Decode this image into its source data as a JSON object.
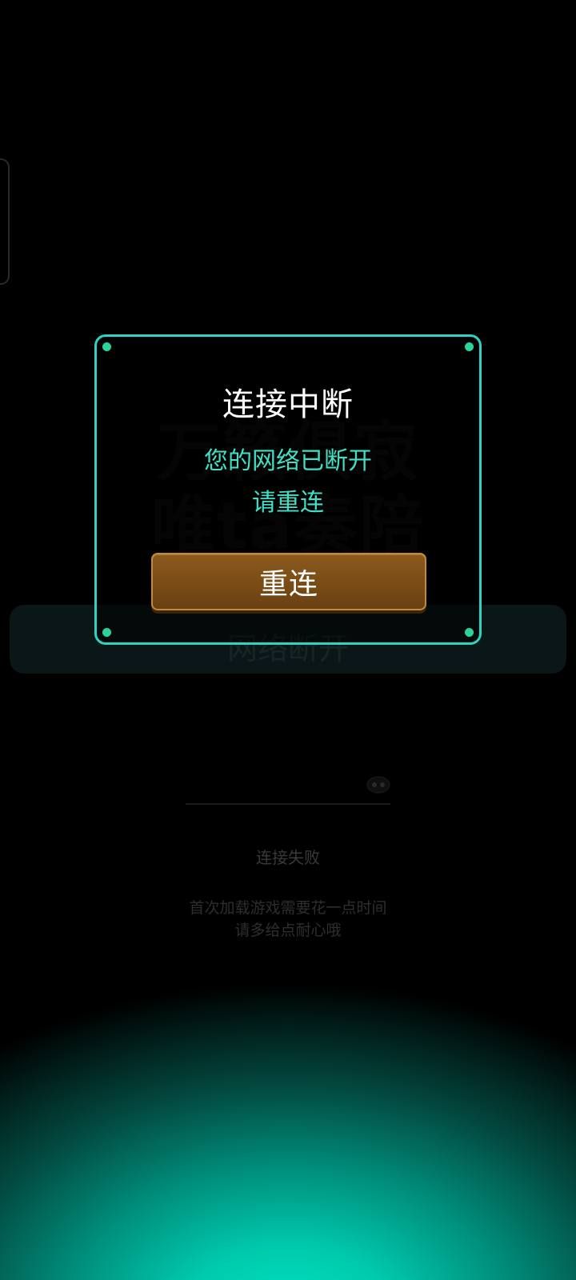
{
  "background": {
    "title_line1": "万籁俱寂",
    "title_line2": "唯ta奏陪",
    "status_bar_text": "网络断开",
    "connect_status": "连接失败",
    "tip_line1": "首次加载游戏需要花一点时间",
    "tip_line2": "请多给点耐心哦"
  },
  "dialog": {
    "title": "连接中断",
    "message_line1": "您的网络已断开",
    "message_line2": "请重连",
    "reconnect_label": "重连"
  },
  "colors": {
    "dialog_border": "#2fd3c3",
    "message_text": "#3fe0c6",
    "button_fill": "#7a4c16",
    "glow": "#00e6c4"
  }
}
